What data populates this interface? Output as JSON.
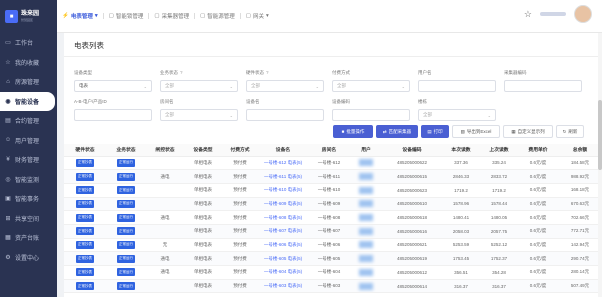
{
  "sidebar": {
    "logo_mark": "■",
    "logo_title": "珠来园",
    "logo_sub": "智慧园区",
    "items": [
      {
        "label": "工作台",
        "icon": "▭"
      },
      {
        "label": "我的收藏",
        "icon": "☆"
      },
      {
        "label": "房源管理",
        "icon": "⌂"
      },
      {
        "label": "智能设备",
        "icon": "◉"
      },
      {
        "label": "合约管理",
        "icon": "▤"
      },
      {
        "label": "用户管理",
        "icon": "☺"
      },
      {
        "label": "财务管理",
        "icon": "¥"
      },
      {
        "label": "智能监测",
        "icon": "◎"
      },
      {
        "label": "智能事务",
        "icon": "▣"
      },
      {
        "label": "共享空间",
        "icon": "⊞"
      },
      {
        "label": "资产台账",
        "icon": "▦"
      },
      {
        "label": "设置中心",
        "icon": "⚙"
      }
    ]
  },
  "topbar": {
    "tabs": [
      {
        "label": "电表管理",
        "icon": "⚡",
        "arrow": "▾"
      },
      {
        "label": "智能锁管理",
        "icon": "▢"
      },
      {
        "label": "采集器管理",
        "icon": "▢"
      },
      {
        "label": "智能源管理",
        "icon": "▢"
      },
      {
        "label": "网关",
        "icon": "▢",
        "arrow": "▾"
      }
    ],
    "star_icon": "☆"
  },
  "page": {
    "title": "电表列表"
  },
  "filters": [
    {
      "label": "设备类型",
      "value": "电表",
      "select": true
    },
    {
      "label": "业务状态",
      "value": "全部",
      "select": true,
      "help": "?"
    },
    {
      "label": "硬件状态",
      "value": "全部",
      "select": true,
      "help": "?"
    },
    {
      "label": "付费方式",
      "value": "全部",
      "select": true
    },
    {
      "label": "用户名",
      "value": "",
      "select": false
    },
    {
      "label": "采集器编码",
      "value": "",
      "select": false
    },
    {
      "label": "A-B-电户/产品ID",
      "value": "",
      "select": false
    },
    {
      "label": "房间名",
      "value": "全部",
      "select": true
    },
    {
      "label": "设备名",
      "value": "",
      "select": false
    },
    {
      "label": "设备编码",
      "value": "",
      "select": false
    },
    {
      "label": "楼栋",
      "value": "全部",
      "select": true
    }
  ],
  "toolbar": {
    "batch": "批量操作",
    "collector": "匹配采集器",
    "print": "打印",
    "export": "导出到Excel",
    "columns": "自定义显示列",
    "refresh": "刷新"
  },
  "table": {
    "headers": [
      "硬件状态",
      "业务状态",
      "闸控状态",
      "设备类型",
      "付费方式",
      "设备名",
      "房间名",
      "用户",
      "设备编码",
      "本次读数",
      "上次读数",
      "费用单价",
      "总余额"
    ],
    "rows": [
      [
        "正常抄表",
        "正常运行",
        "",
        "单相电表",
        "预付费",
        "一号楼-612 电表(5)",
        "一号楼-612",
        "",
        "485205000622",
        "337.36",
        "335.24",
        "0.6元/度",
        "184.58元"
      ],
      [
        "正常抄表",
        "正常运行",
        "通电",
        "单相电表",
        "预付费",
        "一号楼-611 电表(5)",
        "一号楼-611",
        "",
        "485205000615",
        "2846.33",
        "2833.72",
        "0.6元/度",
        "988.92元"
      ],
      [
        "正常抄表",
        "正常运行",
        "",
        "单相电表",
        "预付费",
        "一号楼-610 电表(5)",
        "一号楼-610",
        "",
        "485205000623",
        "1719.2",
        "1719.2",
        "0.6元/度",
        "168.18元"
      ],
      [
        "正常抄表",
        "正常运行",
        "",
        "单相电表",
        "预付费",
        "一号楼-609 电表(5)",
        "一号楼-609",
        "",
        "485205000610",
        "1578.96",
        "1578.44",
        "0.6元/度",
        "670.63元"
      ],
      [
        "正常抄表",
        "正常运行",
        "通电",
        "单相电表",
        "预付费",
        "一号楼-608 电表(5)",
        "一号楼-608",
        "",
        "485205000618",
        "1480.41",
        "1480.05",
        "0.6元/度",
        "702.66元"
      ],
      [
        "正常抄表",
        "正常运行",
        "",
        "单相电表",
        "预付费",
        "一号楼-607 电表(5)",
        "一号楼-607",
        "",
        "485205000616",
        "2058.03",
        "2057.75",
        "0.6元/度",
        "772.71元"
      ],
      [
        "正常抄表",
        "正常运行",
        "无",
        "单相电表",
        "预付费",
        "一号楼-606 电表(5)",
        "一号楼-606",
        "",
        "485205000621",
        "5253.59",
        "5252.12",
        "0.6元/度",
        "142.94元"
      ],
      [
        "正常抄表",
        "正常运行",
        "通电",
        "单相电表",
        "预付费",
        "一号楼-605 电表(5)",
        "一号楼-605",
        "",
        "485205000619",
        "1753.45",
        "1752.37",
        "0.6元/度",
        "290.74元"
      ],
      [
        "正常抄表",
        "正常运行",
        "通电",
        "单相电表",
        "预付费",
        "一号楼-604 电表(5)",
        "一号楼-604",
        "",
        "485205000612",
        "356.51",
        "354.28",
        "0.6元/度",
        "280.14元"
      ],
      [
        "正常抄表",
        "正常运行",
        "",
        "单相电表",
        "预付费",
        "一号楼-603 电表(5)",
        "一号楼-603",
        "",
        "485205000614",
        "316.37",
        "316.37",
        "0.6元/度",
        "507.49元"
      ]
    ]
  }
}
